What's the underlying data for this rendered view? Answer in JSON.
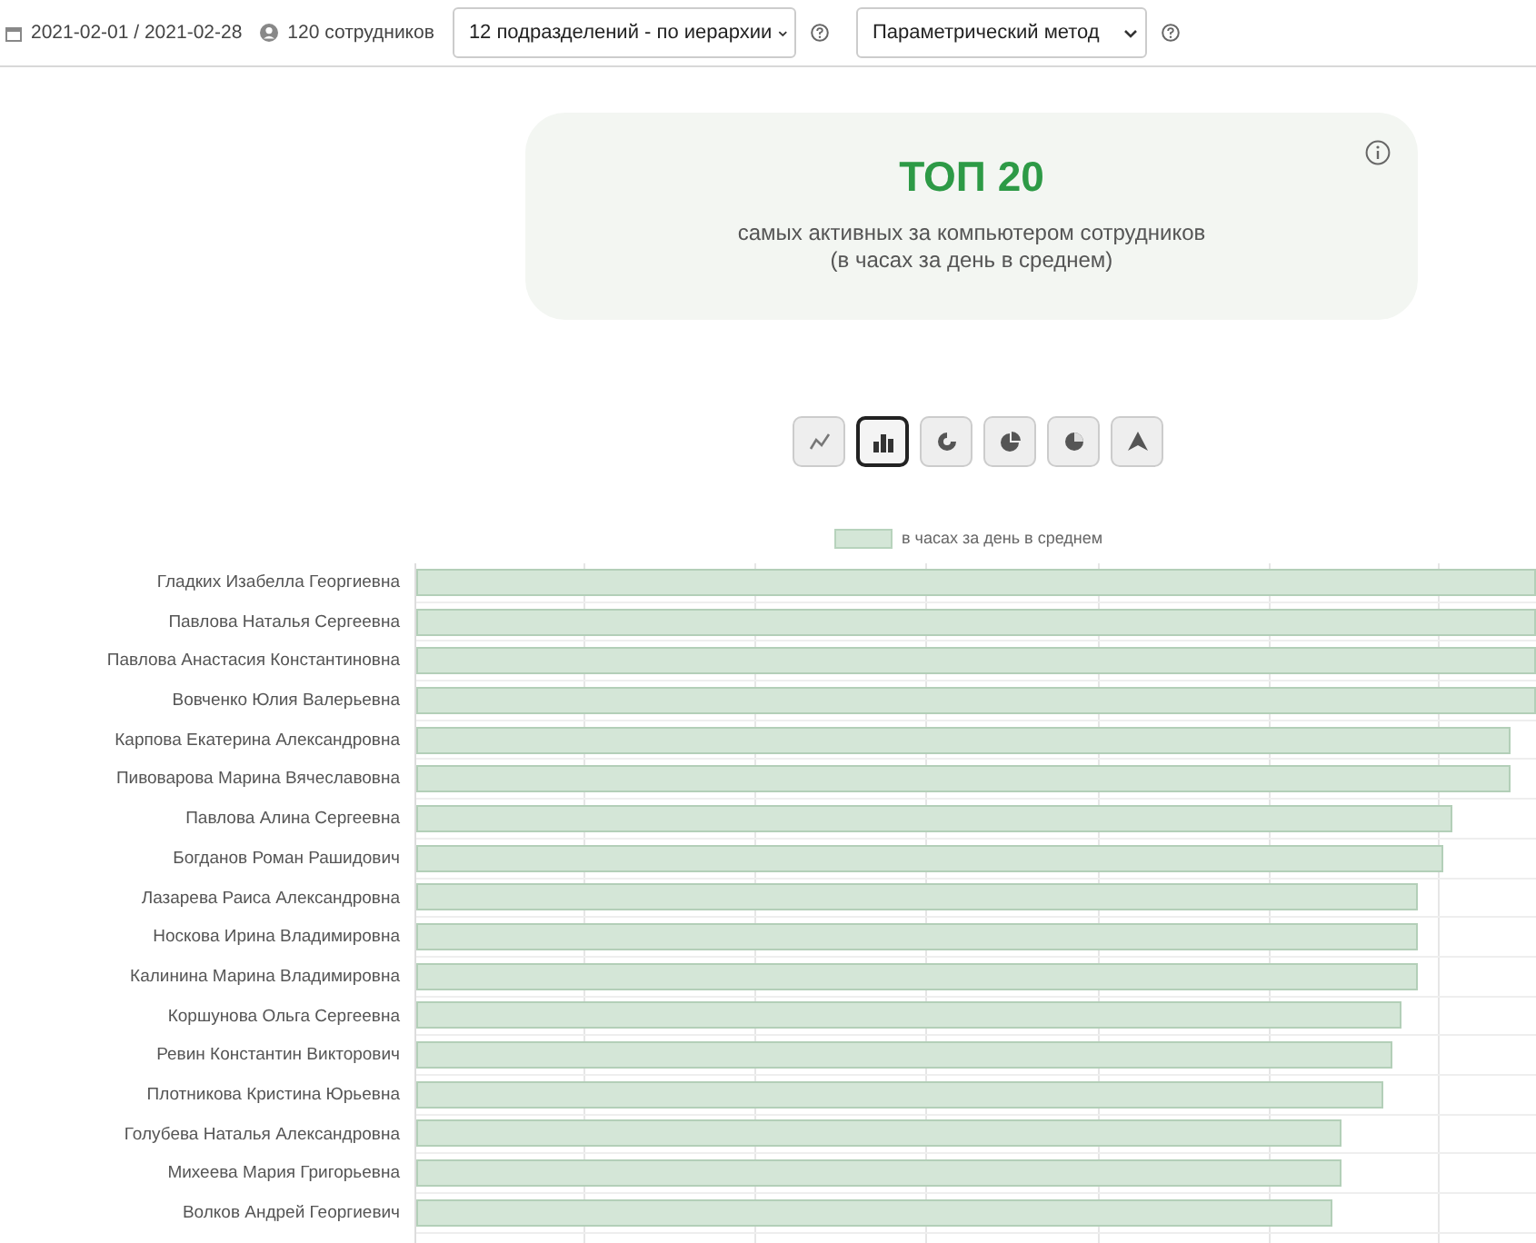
{
  "toolbar": {
    "period": "2021-02-01 / 2021-02-28",
    "employees": "120 сотрудников",
    "department_select": "12 подразделений - по иерархии",
    "method_select": "Параметрический метод"
  },
  "summary_card": {
    "title": "ТОП 20",
    "subtitle": "самых активных за компьютером сотрудников",
    "note": "(в часах за день в среднем)"
  },
  "chart_types": [
    {
      "kind": "line",
      "selected": false
    },
    {
      "kind": "bar",
      "selected": true
    },
    {
      "kind": "donut",
      "selected": false
    },
    {
      "kind": "pie",
      "selected": false
    },
    {
      "kind": "polar",
      "selected": false
    },
    {
      "kind": "radar",
      "selected": false
    }
  ],
  "legend": "в часах за день в среднем",
  "rows": [
    {
      "name": "Гладких Изабелла Георгиевна",
      "level": 1
    },
    {
      "name": "Павлова Наталья Сергеевна",
      "level": 1
    },
    {
      "name": "Павлова Анастасия Константиновна",
      "level": 1
    },
    {
      "name": "Вовченко Юлия Валерьевна",
      "level": 1
    },
    {
      "name": "Карпова Екатерина Александровна",
      "level": 0.977
    },
    {
      "name": "Пивоварова Марина Вячеславовна",
      "level": 0.977
    },
    {
      "name": "Павлова Алина Сергеевна",
      "level": 0.925
    },
    {
      "name": "Богданов Роман Рашидович",
      "level": 0.917
    },
    {
      "name": "Лазарева Раиса Александровна",
      "level": 0.895
    },
    {
      "name": "Носкова Ирина Владимировна",
      "level": 0.895
    },
    {
      "name": "Калинина Марина Владимировна",
      "level": 0.895
    },
    {
      "name": "Коршунова Ольга Сергеевна",
      "level": 0.88
    },
    {
      "name": "Ревин Константин Викторович",
      "level": 0.872
    },
    {
      "name": "Плотникова Кристина Юрьевна",
      "level": 0.864
    },
    {
      "name": "Голубева Наталья Александровна",
      "level": 0.827
    },
    {
      "name": "Михеева Мария Григорьевна",
      "level": 0.827
    },
    {
      "name": "Волков Андрей Георгиевич",
      "level": 0.818
    }
  ]
}
